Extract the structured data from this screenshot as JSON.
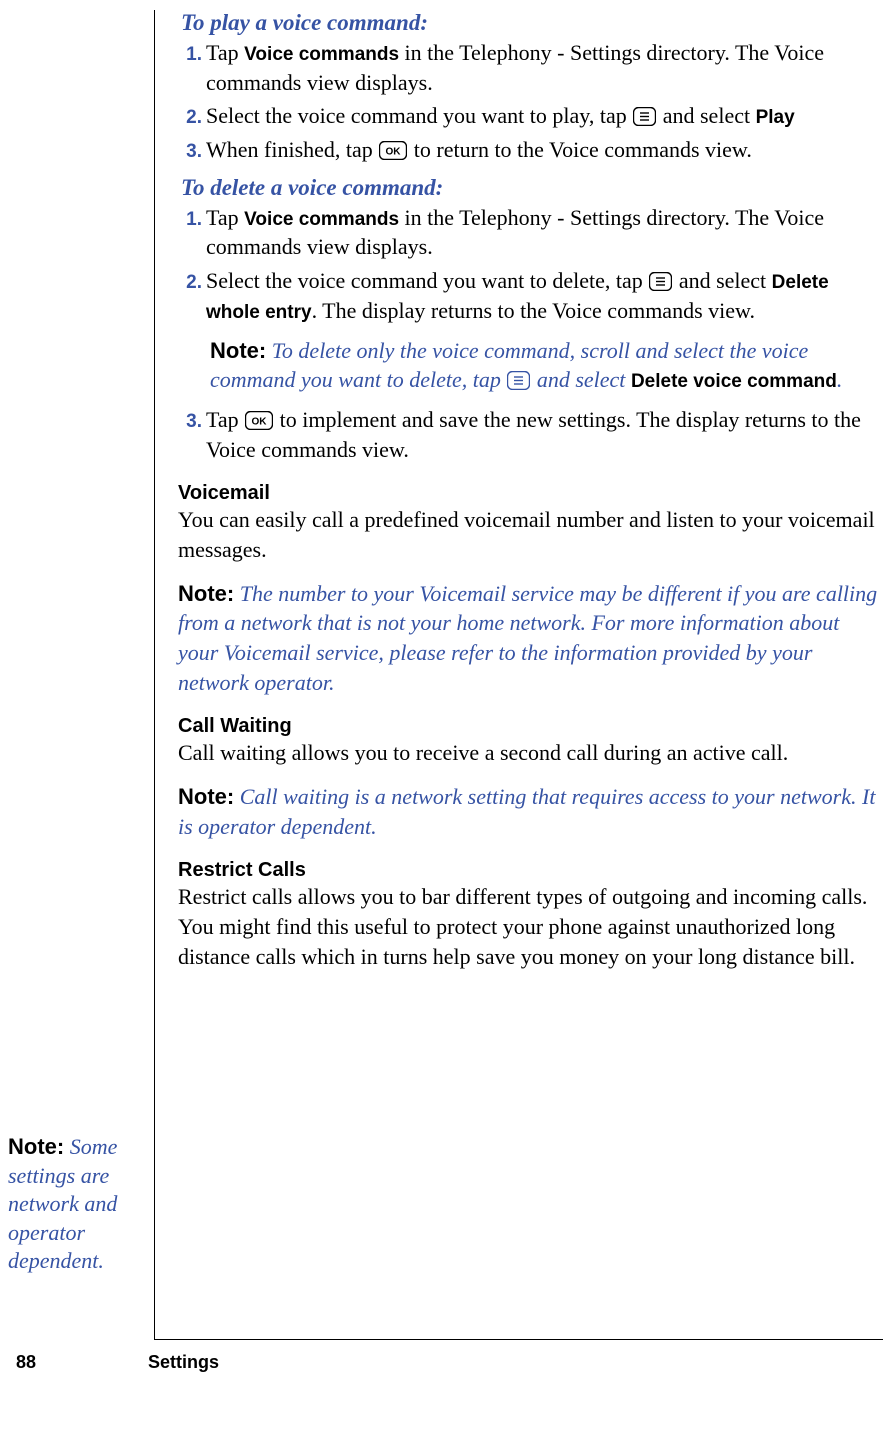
{
  "section1": {
    "heading": "To play a voice command:",
    "steps": [
      {
        "num": "1.",
        "pre": "Tap ",
        "ui": "Voice commands",
        "post": " in the Telephony - Settings directory. The Voice commands view displays."
      },
      {
        "num": "2.",
        "pre": "Select the voice command you want to play, tap ",
        "icon": "menu",
        "mid": " and select ",
        "ui2": "Play"
      },
      {
        "num": "3.",
        "pre": "When finished, tap ",
        "icon": "ok",
        "post": " to return to the Voice commands view."
      }
    ]
  },
  "section2": {
    "heading": "To delete a voice command:",
    "steps": [
      {
        "num": "1.",
        "pre": "Tap ",
        "ui": "Voice commands",
        "post": " in the Telephony - Settings directory. The Voice commands view displays."
      },
      {
        "num": "2.",
        "pre": "Select the voice command you want to delete, tap ",
        "icon": "menu",
        "mid": " and select ",
        "ui2": "Delete whole entry",
        "post2": ". The display returns to the Voice commands view."
      }
    ],
    "inline_note": {
      "label": "Note:",
      "text_before": "  To delete only the voice command, scroll and select the voice command you want to delete, tap ",
      "text_after": " and select ",
      "ui": "Delete voice command",
      "tail": "."
    },
    "step3": {
      "num": "3.",
      "pre": "Tap ",
      "icon": "ok",
      "post": " to implement and save the new settings. The display returns to the Voice commands view."
    }
  },
  "voicemail": {
    "heading": "Voicemail",
    "body": "You can easily call a predefined voicemail number and listen to your voicemail messages.",
    "note_label": "Note:",
    "note_text": "  The number to your Voicemail service may be different if you are calling from a network that is not your home network. For more information about your Voicemail service, please refer to the information provided by your network operator."
  },
  "callwaiting": {
    "heading": "Call Waiting",
    "body": "Call waiting allows you to receive a second call during an active call.",
    "note_label": "Note:",
    "note_text": "  Call waiting is a network setting that requires access to your network. It is operator dependent."
  },
  "restrict": {
    "heading": "Restrict Calls",
    "body": "Restrict calls allows you to bar different types of outgoing and incoming calls. You might find this useful to protect your phone against unauthorized long distance calls which in turns help save you money on your long distance bill."
  },
  "side_note": {
    "label": "Note:",
    "text": "  Some settings are network and operator dependent."
  },
  "footer": {
    "page": "88",
    "chapter": "Settings"
  }
}
